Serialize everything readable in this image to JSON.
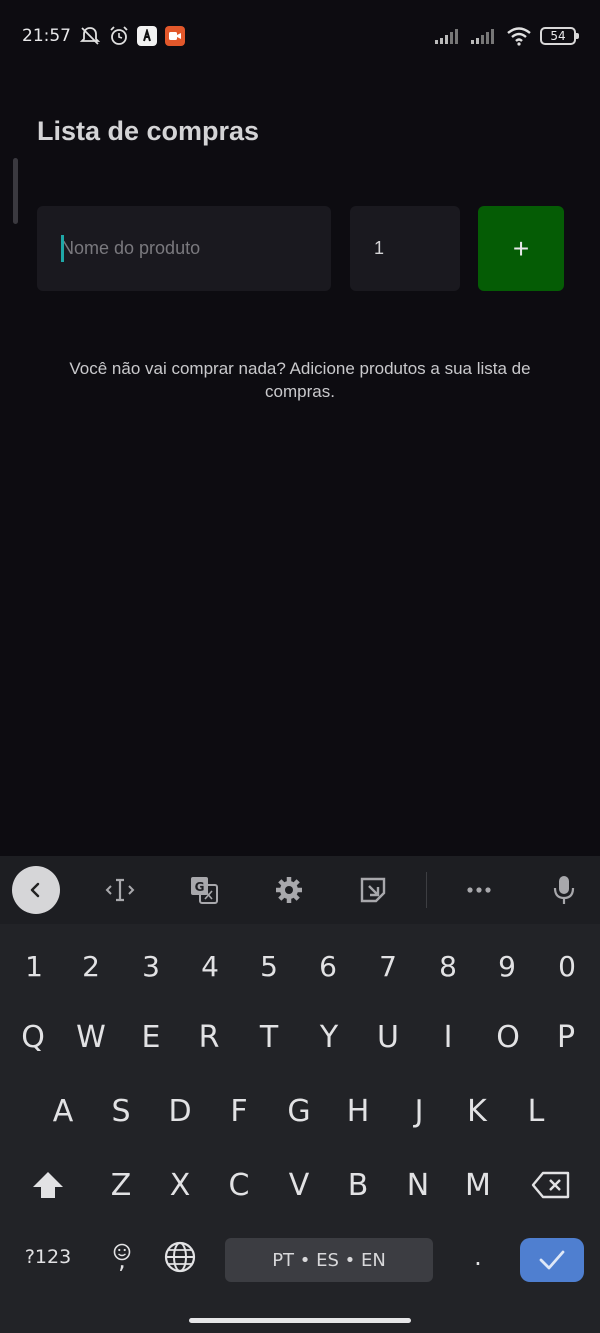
{
  "status_bar": {
    "time": "21:57",
    "battery": "54",
    "icons": [
      "notifications-off-icon",
      "alarm-icon",
      "app-badge-icon",
      "video-badge-icon",
      "signal-icon",
      "signal-icon",
      "wifi-icon",
      "battery-icon"
    ]
  },
  "page": {
    "title": "Lista de compras"
  },
  "form": {
    "product_placeholder": "Nome do produto",
    "product_value": "",
    "quantity_value": "1",
    "add_label": "+"
  },
  "empty_message": "Você não vai comprar nada? Adicione produtos a sua lista de compras.",
  "keyboard": {
    "toolbar": [
      "back-icon",
      "cursor-icon",
      "translate-icon",
      "gear-icon",
      "sticker-icon",
      "more-icon",
      "mic-icon"
    ],
    "row_numbers": [
      "1",
      "2",
      "3",
      "4",
      "5",
      "6",
      "7",
      "8",
      "9",
      "0"
    ],
    "row_1": [
      "Q",
      "W",
      "E",
      "R",
      "T",
      "Y",
      "U",
      "I",
      "O",
      "P"
    ],
    "row_2": [
      "A",
      "S",
      "D",
      "F",
      "G",
      "H",
      "J",
      "K",
      "L"
    ],
    "row_3": [
      "Z",
      "X",
      "C",
      "V",
      "B",
      "N",
      "M"
    ],
    "symbols_label": "?123",
    "emoji_comma": ",",
    "space_label": "PT • ES • EN",
    "period": "."
  },
  "colors": {
    "background": "#0d0c11",
    "field": "#1a191f",
    "add_button": "#055c05",
    "caret": "#1fa7a7",
    "enter_key": "#4f7fd0"
  }
}
